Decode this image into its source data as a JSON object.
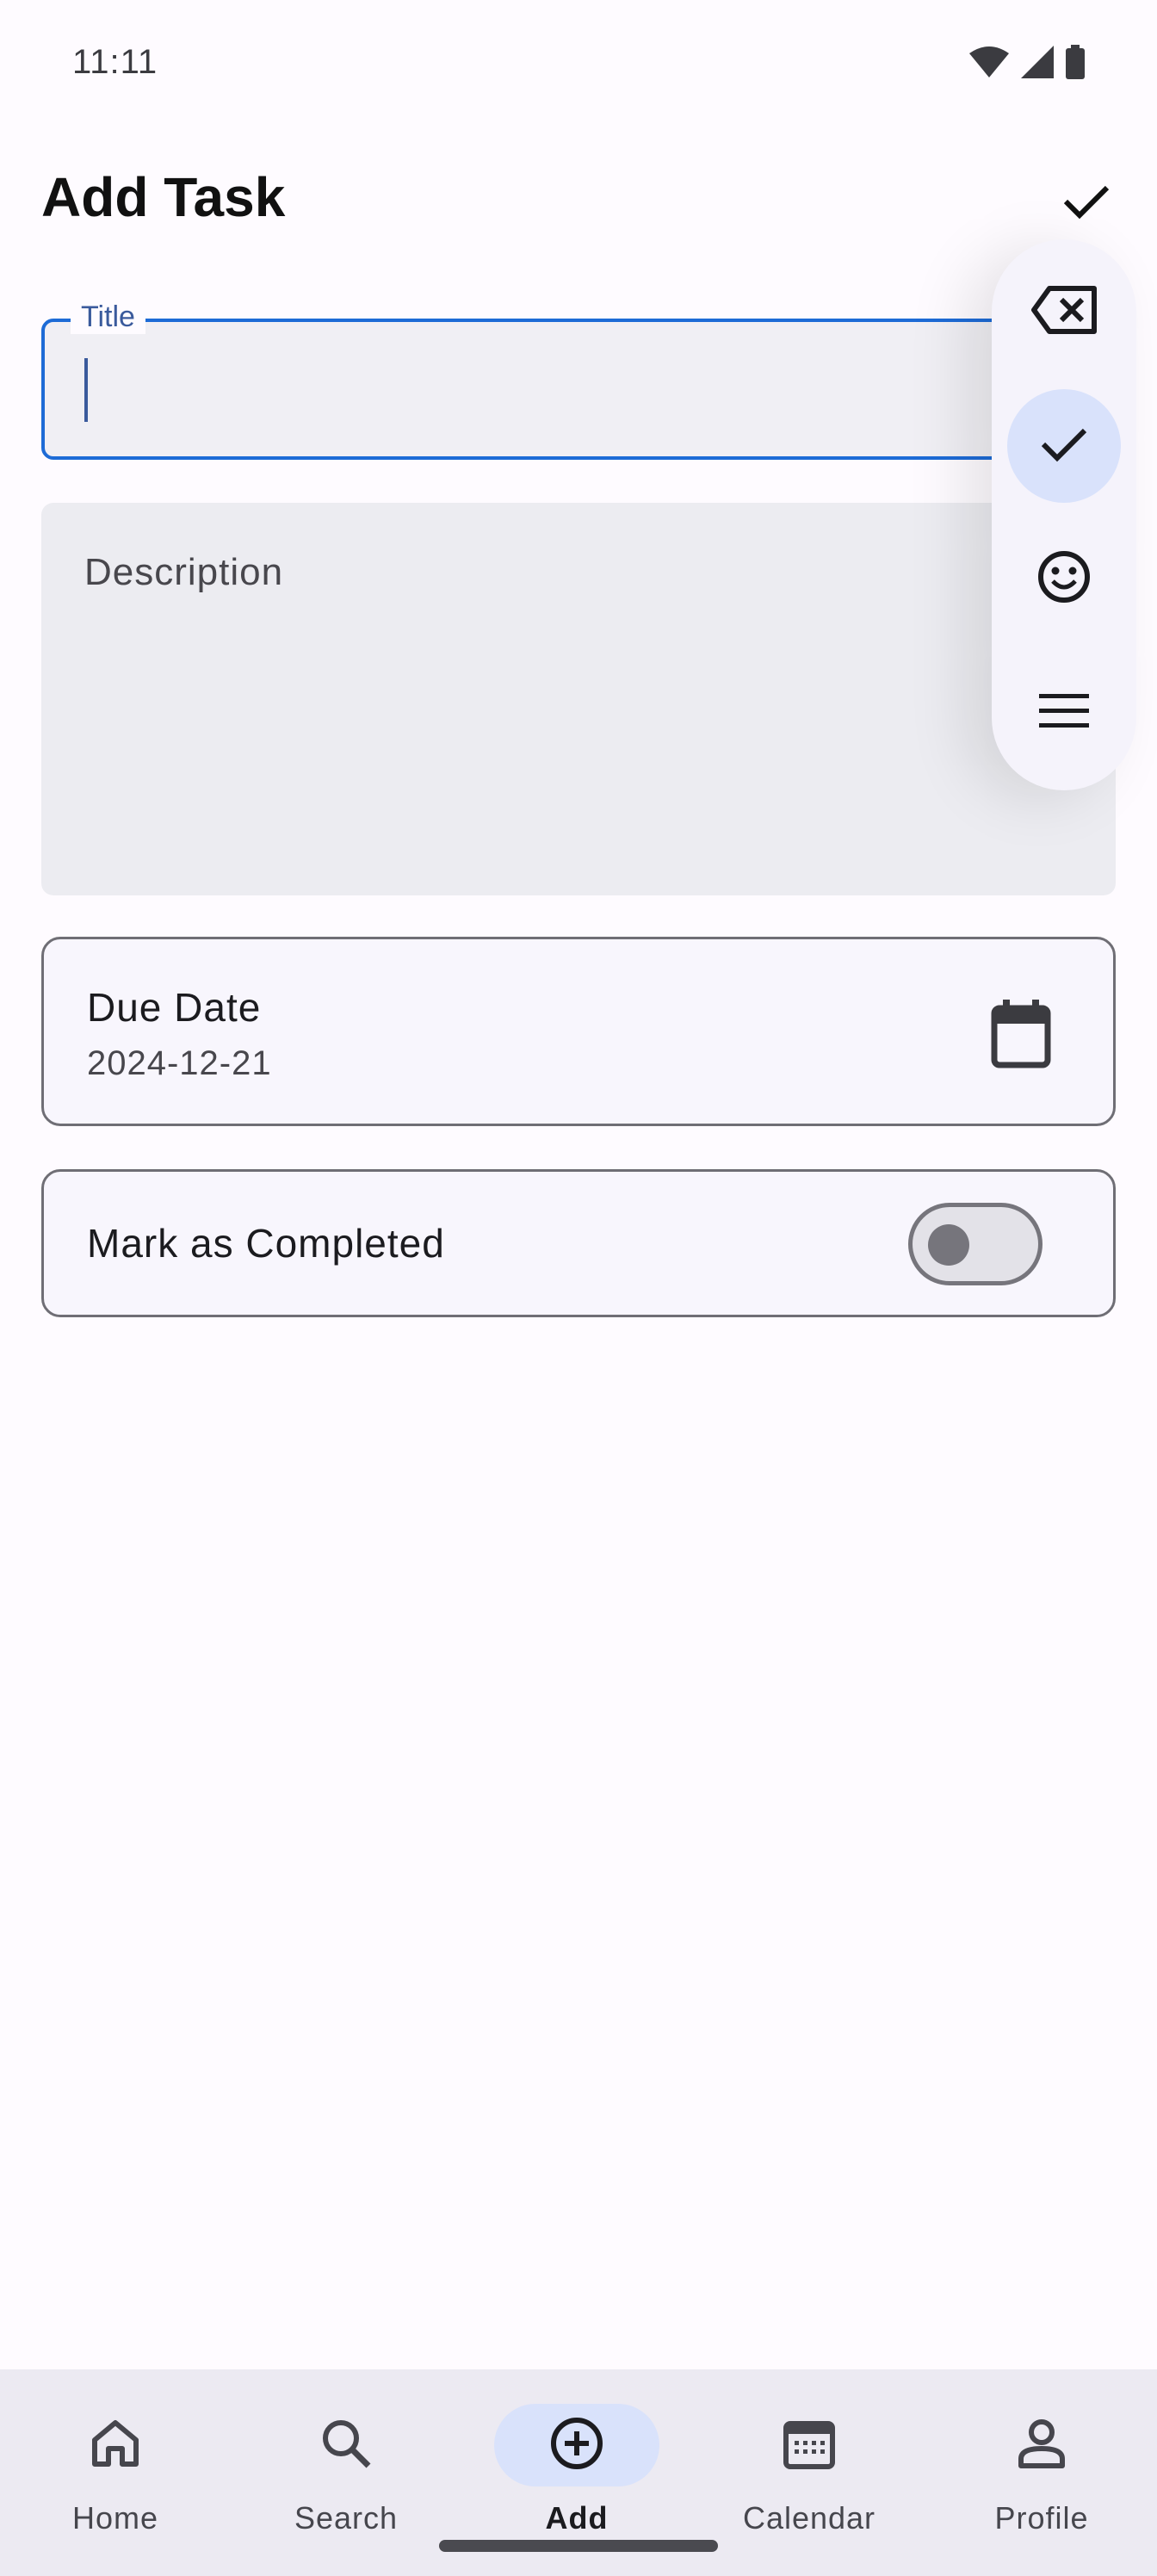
{
  "status_bar": {
    "time": "11:11",
    "icons": [
      "wifi-icon",
      "cell-signal-icon",
      "battery-icon"
    ]
  },
  "app_bar": {
    "title": "Add Task",
    "save_icon": "check-icon"
  },
  "form": {
    "title_field": {
      "label": "Title",
      "value": "",
      "focused": true
    },
    "description_field": {
      "placeholder": "Description",
      "value": ""
    },
    "due_date": {
      "label": "Due Date",
      "value": "2024-12-21",
      "icon": "calendar-icon"
    },
    "completed": {
      "label": "Mark as Completed",
      "checked": false
    }
  },
  "floating_toolbar": {
    "items": [
      {
        "icon": "backspace-icon",
        "active": false
      },
      {
        "icon": "check-icon",
        "active": true
      },
      {
        "icon": "emoji-icon",
        "active": false
      },
      {
        "icon": "menu-icon",
        "active": false
      }
    ]
  },
  "bottom_nav": {
    "items": [
      {
        "label": "Home",
        "icon": "home-icon",
        "active": false
      },
      {
        "label": "Search",
        "icon": "search-icon",
        "active": false
      },
      {
        "label": "Add",
        "icon": "add-circle-icon",
        "active": true
      },
      {
        "label": "Calendar",
        "icon": "calendar-icon",
        "active": false
      },
      {
        "label": "Profile",
        "icon": "person-icon",
        "active": false
      }
    ]
  },
  "colors": {
    "accent": "#1d6bd6",
    "label": "#3a5a9c",
    "active_pill": "#d9e2fb",
    "nav_background": "#eceaf2"
  }
}
